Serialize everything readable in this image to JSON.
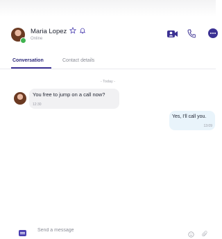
{
  "header": {
    "contact_name": "Maria Lopez",
    "status": "Online"
  },
  "tabs": [
    {
      "label": "Conversation",
      "active": true
    },
    {
      "label": "Contact details",
      "active": false
    }
  ],
  "day_separator": "- Today -",
  "messages": [
    {
      "direction": "incoming",
      "text": "You free to jump on a call now?",
      "time": "12:30"
    },
    {
      "direction": "outgoing",
      "text": "Yes, I'll call you.",
      "time": "13:09"
    }
  ],
  "composer": {
    "placeholder": "Send a message"
  },
  "colors": {
    "accent": "#3b3193",
    "online": "#3fb34f",
    "outgoing_bubble": "#e9f4fb",
    "incoming_bubble": "#f1f1f3"
  },
  "icons": [
    "star-icon",
    "bell-icon",
    "video-call-icon",
    "phone-icon",
    "more-icon",
    "chat-icon",
    "emoji-icon",
    "attachment-icon"
  ]
}
